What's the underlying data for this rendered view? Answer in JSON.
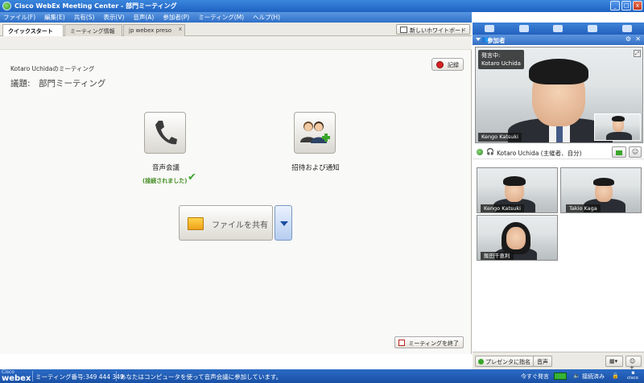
{
  "window": {
    "title": "Cisco WebEx Meeting Center - 部門ミーティング",
    "min": "_",
    "max": "□",
    "close": "x"
  },
  "menu": [
    "ファイル(F)",
    "編集(E)",
    "共有(S)",
    "表示(V)",
    "音声(A)",
    "参加者(P)",
    "ミーティング(M)",
    "ヘルプ(H)"
  ],
  "tabs": [
    {
      "label": "クイックスタート",
      "active": true
    },
    {
      "label": "ミーティング情報",
      "active": false
    },
    {
      "label": "jp webex preso",
      "active": false,
      "close": "x"
    }
  ],
  "toolbar": {
    "new_whiteboard": "新しいホワイトボード"
  },
  "quickstart": {
    "host_meeting": "Kotaro Uchidaのミーティング",
    "agenda": "議題:　部門ミーティング",
    "record_button": "記録",
    "audio_label": "音声会議",
    "audio_status": "(接続されました)",
    "invite_label": "招待および通知",
    "share_file_button": "ファイルを共有",
    "end_meeting_button": "ミーティングを終了"
  },
  "participants_panel": {
    "title": "参加者",
    "active_speaker_badge": "発言中:",
    "active_speaker_name": "Kotaro Uchida",
    "main_video_name": "Kengo Katsuki",
    "host_entry": "Kotaro Uchida (主催者、自分)",
    "thumbnails": [
      {
        "name": "Kengo Katsuki"
      },
      {
        "name": "Takio Kaga"
      },
      {
        "name": "飯田千恵利"
      }
    ],
    "bottom_buttons": {
      "presenter": "プレゼンタに指名",
      "audio": "音声"
    }
  },
  "statusbar": {
    "brand_small": "Cisco",
    "brand": "webex",
    "meeting_number": "ミーティング番号:349 444 349",
    "audio_message": "あなたはコンピュータを使って音声会議に参加しています。",
    "speaking_now": "今すぐ発言",
    "connection": "接続済み",
    "cisco_logo": "cisco"
  }
}
